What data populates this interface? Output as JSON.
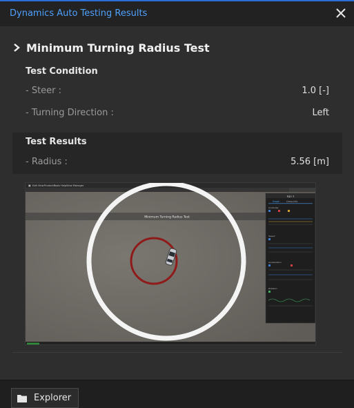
{
  "window": {
    "title": "Dynamics Auto Testing Results"
  },
  "test": {
    "name": "Minimum Turning Radius Test",
    "condition": {
      "heading": "Test Condition",
      "rows": [
        {
          "label": "- Steer :",
          "value": "1.0 [-]"
        },
        {
          "label": "- Turning Direction :",
          "value": "Left"
        }
      ]
    },
    "results": {
      "heading": "Test Results",
      "rows": [
        {
          "label": "- Radius :",
          "value": "5.56 [m]"
        }
      ]
    },
    "screenshot": {
      "banner": "Minimum Turning Radius Test",
      "menu": [
        "Edit",
        "View",
        "Products",
        "Tools",
        "Help",
        "View Manager"
      ],
      "side_panel_title": "Ego 3",
      "side_panel_tabs": [
        "Graph",
        "Comp.Info"
      ],
      "graph_sections": [
        "Controller",
        "Speed",
        "Acceleration",
        "Rotation"
      ]
    }
  },
  "footer": {
    "explorer_label": "Explorer"
  },
  "colors": {
    "accent": "#4ea1ff",
    "circle_outer": "#ffffff",
    "circle_inner": "#9b1b1b"
  }
}
